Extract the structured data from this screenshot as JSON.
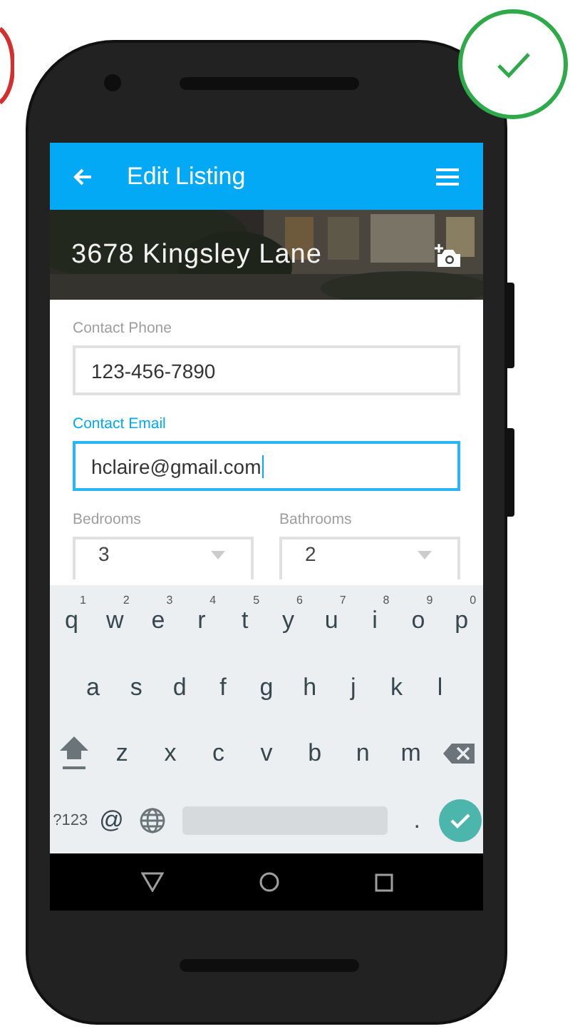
{
  "app_bar": {
    "title": "Edit Listing"
  },
  "header": {
    "title": "3678 Kingsley Lane"
  },
  "fields": [
    {
      "label": "Contact Phone",
      "value": "123-456-7890",
      "focused": false
    },
    {
      "label": "Contact Email",
      "value": "hclaire@gmail.com",
      "focused": true
    }
  ],
  "selects": [
    {
      "label": "Bedrooms",
      "value": "3"
    },
    {
      "label": "Bathrooms",
      "value": "2"
    }
  ],
  "keyboard": {
    "rows": [
      [
        {
          "kind": "char",
          "label": "q",
          "hint": "1"
        },
        {
          "kind": "char",
          "label": "w",
          "hint": "2"
        },
        {
          "kind": "char",
          "label": "e",
          "hint": "3"
        },
        {
          "kind": "char",
          "label": "r",
          "hint": "4"
        },
        {
          "kind": "char",
          "label": "t",
          "hint": "5"
        },
        {
          "kind": "char",
          "label": "y",
          "hint": "6"
        },
        {
          "kind": "char",
          "label": "u",
          "hint": "7"
        },
        {
          "kind": "char",
          "label": "i",
          "hint": "8"
        },
        {
          "kind": "char",
          "label": "o",
          "hint": "9"
        },
        {
          "kind": "char",
          "label": "p",
          "hint": "0"
        }
      ],
      [
        {
          "kind": "char",
          "label": "a"
        },
        {
          "kind": "char",
          "label": "s"
        },
        {
          "kind": "char",
          "label": "d"
        },
        {
          "kind": "char",
          "label": "f"
        },
        {
          "kind": "char",
          "label": "g"
        },
        {
          "kind": "char",
          "label": "h"
        },
        {
          "kind": "char",
          "label": "j"
        },
        {
          "kind": "char",
          "label": "k"
        },
        {
          "kind": "char",
          "label": "l"
        }
      ],
      [
        {
          "kind": "shift"
        },
        {
          "kind": "char",
          "label": "z"
        },
        {
          "kind": "char",
          "label": "x"
        },
        {
          "kind": "char",
          "label": "c"
        },
        {
          "kind": "char",
          "label": "v"
        },
        {
          "kind": "char",
          "label": "b"
        },
        {
          "kind": "char",
          "label": "n"
        },
        {
          "kind": "char",
          "label": "m"
        },
        {
          "kind": "backspace"
        }
      ],
      [
        {
          "kind": "symbols",
          "label": "?123"
        },
        {
          "kind": "char",
          "label": "@"
        },
        {
          "kind": "globe"
        },
        {
          "kind": "space"
        },
        {
          "kind": "char",
          "label": "."
        },
        {
          "kind": "enter"
        }
      ]
    ]
  }
}
